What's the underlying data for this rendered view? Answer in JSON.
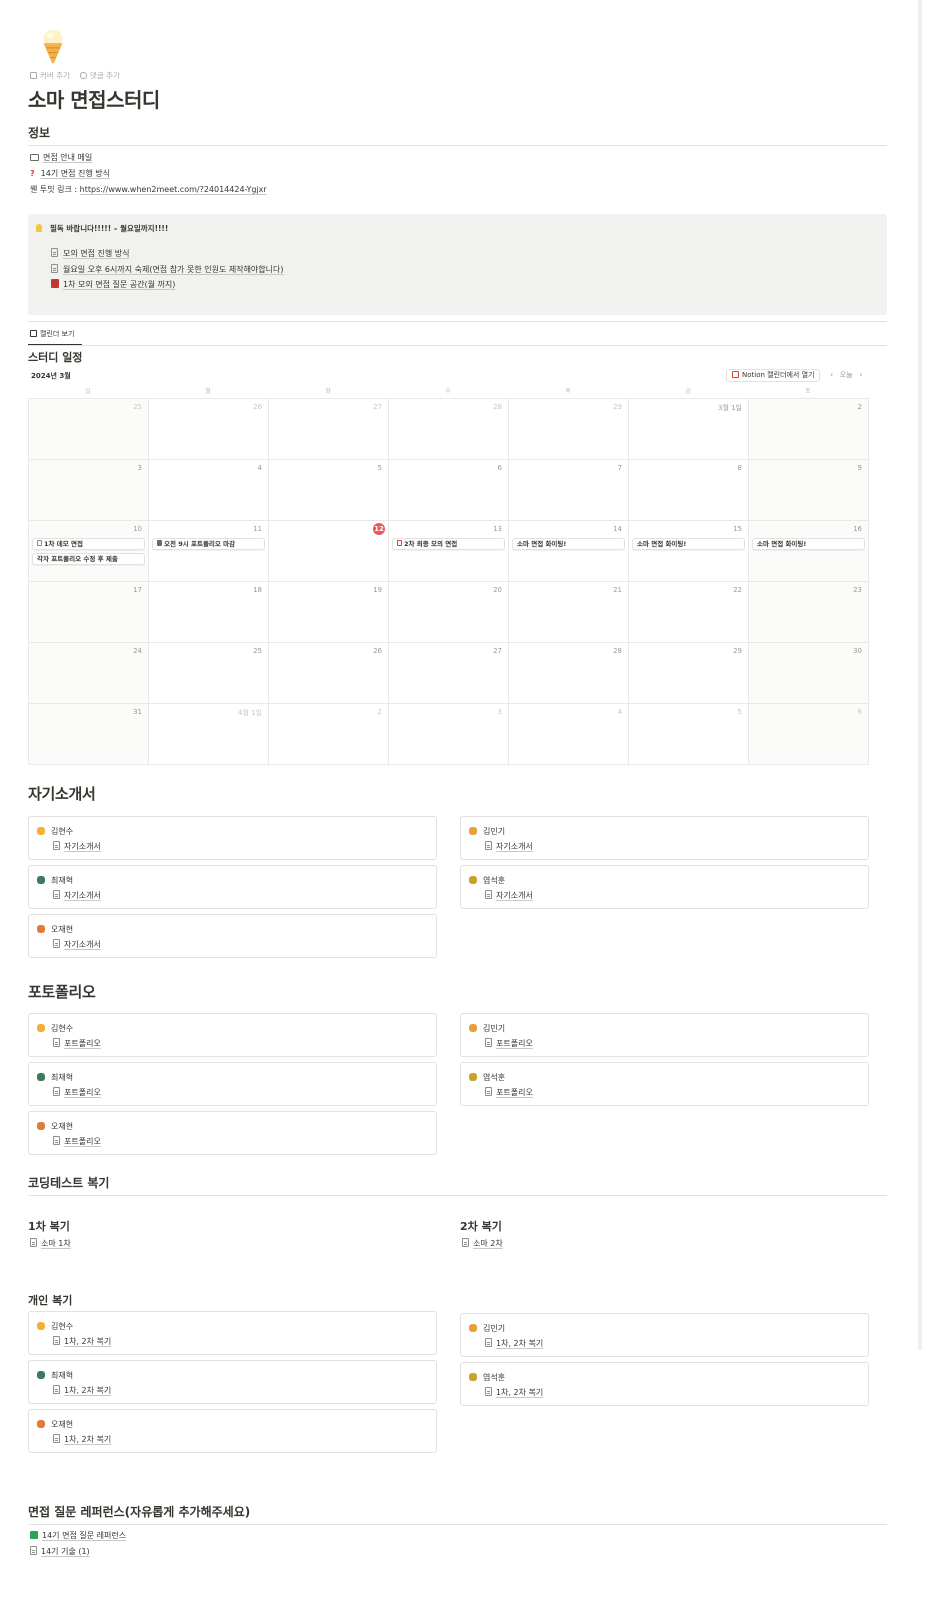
{
  "page": {
    "title": "소마 면접스터디",
    "cover_action": "커버 추가",
    "comment_action": "댓글 추가"
  },
  "info": {
    "heading": "정보",
    "links": [
      {
        "icon": "envelope-icon",
        "text": "면접 안내 메일"
      },
      {
        "icon": "question-icon",
        "text": "14기 면접 진행 방식"
      }
    ],
    "when2meet_label": "웬 투밋 링크 : ",
    "when2meet_url": "https://www.when2meet.com/?24014424-Ygjxr"
  },
  "callout": {
    "title": "필독 바랍니다!!!!! – 월요일까지!!!!",
    "items": [
      {
        "icon": "page-icon",
        "text": "모의 면접 진행 방식"
      },
      {
        "icon": "page-icon",
        "text": "월요일 오후 6시까지 숙제(면접 참가 못한 인원도 제작해야합니다)"
      },
      {
        "icon": "book-icon",
        "text": "1차 모의 면접 질문 공간(월 까지)"
      }
    ]
  },
  "calendar": {
    "view_tab": "캘린더 보기",
    "title": "스터디 일정",
    "month": "2024년 3월",
    "open_in_notion": "Notion 캘린더에서 열기",
    "today_label": "오늘",
    "weekdays": [
      "일",
      "월",
      "화",
      "수",
      "목",
      "금",
      "토"
    ],
    "weeks": [
      [
        "25",
        "26",
        "27",
        "28",
        "29",
        "3월 1일",
        "2"
      ],
      [
        "3",
        "4",
        "5",
        "6",
        "7",
        "8",
        "9"
      ],
      [
        "10",
        "11",
        "12",
        "13",
        "14",
        "15",
        "16"
      ],
      [
        "17",
        "18",
        "19",
        "20",
        "21",
        "22",
        "23"
      ],
      [
        "24",
        "25",
        "26",
        "27",
        "28",
        "29",
        "30"
      ],
      [
        "31",
        "4월 1일",
        "2",
        "3",
        "4",
        "5",
        "6"
      ]
    ],
    "events": [
      {
        "text": "1차 데모 면접",
        "week": 2,
        "day": 0,
        "slot": 0,
        "icon": "page-icon"
      },
      {
        "text": "각자 포트폴리오 수정 후 제출",
        "week": 2,
        "day": 0,
        "slot": 1
      },
      {
        "text": "오전 9시 포트폴리오 마감",
        "week": 2,
        "day": 1,
        "slot": 0,
        "icon": "folder-icon"
      },
      {
        "text": "2차 최종 모의 면접",
        "week": 2,
        "day": 3,
        "slot": 0,
        "icon": "calendar-icon"
      },
      {
        "text": "소마 면접 화이팅!",
        "week": 2,
        "day": 4,
        "slot": 0
      },
      {
        "text": "소마 면접 화이팅!",
        "week": 2,
        "day": 5,
        "slot": 0
      },
      {
        "text": "소마 면접 화이팅!",
        "week": 2,
        "day": 6,
        "slot": 0
      }
    ]
  },
  "resume": {
    "heading": "자기소개서",
    "cards": [
      {
        "name": "김현수",
        "doc": "자기소개서",
        "icon": "trophy-icon",
        "color": "#f2b134"
      },
      {
        "name": "김민기",
        "doc": "자기소개서",
        "icon": "person-icon",
        "color": "#e8a13a"
      },
      {
        "name": "최재혁",
        "doc": "자기소개서",
        "icon": "person-icon",
        "color": "#3d7a59"
      },
      {
        "name": "염석훈",
        "doc": "자기소개서",
        "icon": "book-icon",
        "color": "#c9a227"
      },
      {
        "name": "오재현",
        "doc": "자기소개서",
        "icon": "person-icon",
        "color": "#e07b39"
      }
    ]
  },
  "portfolio": {
    "heading": "포토폴리오",
    "cards": [
      {
        "name": "김현수",
        "doc": "포트폴리오",
        "icon": "trophy-icon",
        "color": "#f2b134"
      },
      {
        "name": "김민기",
        "doc": "포트폴리오",
        "icon": "person-icon",
        "color": "#e8a13a"
      },
      {
        "name": "최재혁",
        "doc": "포트폴리오",
        "icon": "person-icon",
        "color": "#3d7a59"
      },
      {
        "name": "염석훈",
        "doc": "포트폴리오",
        "icon": "book-icon",
        "color": "#c9a227"
      },
      {
        "name": "오재현",
        "doc": "포트폴리오",
        "icon": "person-icon",
        "color": "#e07b39"
      }
    ]
  },
  "coding_review": {
    "heading": "코딩테스트 복기",
    "first": {
      "title": "1차 복기",
      "link": "소마 1차"
    },
    "second": {
      "title": "2차 복기",
      "link": "소마 2차"
    }
  },
  "personal_review": {
    "heading": "개인 복기",
    "cards": [
      {
        "name": "김현수",
        "doc": "1차, 2차 복기",
        "icon": "trophy-icon",
        "color": "#f2b134"
      },
      {
        "name": "김민기",
        "doc": "1차, 2차 복기",
        "icon": "person-icon",
        "color": "#e8a13a"
      },
      {
        "name": "최재혁",
        "doc": "1차, 2차 복기",
        "icon": "person-icon",
        "color": "#3d7a59"
      },
      {
        "name": "염석훈",
        "doc": "1차, 2차 복기",
        "icon": "book-icon",
        "color": "#c9a227"
      },
      {
        "name": "오재현",
        "doc": "1차, 2차 복기",
        "icon": "person-icon",
        "color": "#e07b39"
      }
    ]
  },
  "references": {
    "heading": "면접 질문 레퍼런스(자유롭게 추가해주세요)",
    "links": [
      {
        "icon": "checkbox-icon",
        "text": "14기 면접 질문 레퍼런스"
      },
      {
        "icon": "page-icon",
        "text": "14기 기술 (1)"
      }
    ]
  }
}
